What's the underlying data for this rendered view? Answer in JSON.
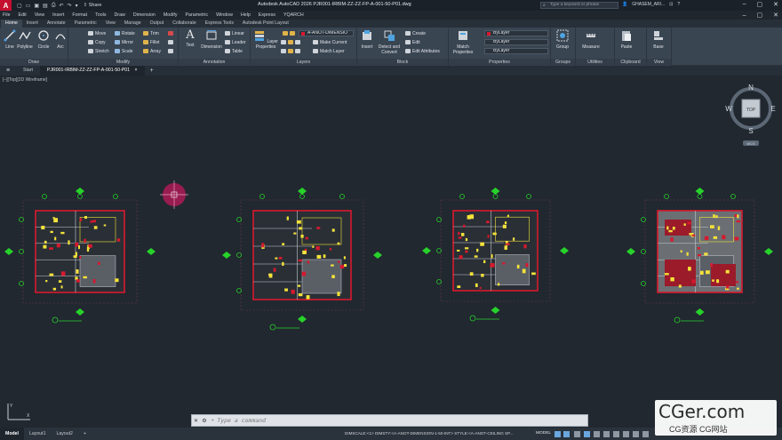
{
  "titlebar": {
    "logo": "A",
    "share_label": "Share",
    "doc_title": "Autodesk AutoCAD 2026    PJR001-IRBIM-ZZ-ZZ-FP-A-001-50-P01.dwg",
    "search_placeholder": "Type a keyword or phrase",
    "user_name": "GHASEM_ARI..."
  },
  "menubar": {
    "items": [
      "File",
      "Edit",
      "View",
      "Insert",
      "Format",
      "Tools",
      "Draw",
      "Dimension",
      "Modify",
      "Parametric",
      "Window",
      "Help",
      "Express",
      "YQARCH"
    ]
  },
  "ribbon_tabs": {
    "items": [
      "Home",
      "Insert",
      "Annotate",
      "Parametric",
      "View",
      "Manage",
      "Output",
      "Collaborate",
      "Express Tools",
      "Autodesk Point Layout"
    ]
  },
  "ribbon": {
    "draw": {
      "label": "Draw",
      "line": "Line",
      "polyline": "Polyline",
      "circle": "Circle",
      "arc": "Arc"
    },
    "modify": {
      "label": "Modify",
      "move": "Move",
      "rotate": "Rotate",
      "trim": "Trim",
      "copy": "Copy",
      "mirror": "Mirror",
      "fillet": "Fillet",
      "stretch": "Stretch",
      "scale": "Scale",
      "array": "Array"
    },
    "annotation": {
      "label": "Annotation",
      "text": "Text",
      "dimension": "Dimension",
      "linear": "Linear",
      "leader": "Leader",
      "table": "Table"
    },
    "layers": {
      "label": "Layers",
      "layer_properties": "Layer Properties",
      "current_layer": "A-ANOT-DIMENSIO",
      "make_current": "Make Current",
      "match_layer": "Match Layer"
    },
    "block": {
      "label": "Block",
      "insert": "Insert",
      "detect": "Detect and Convert",
      "create": "Create",
      "edit": "Edit",
      "edit_attributes": "Edit Attributes"
    },
    "properties": {
      "label": "Properties",
      "match": "Match Properties",
      "color": "ByLayer",
      "linetype": "ByLayer",
      "lineweight": "ByLayer"
    },
    "groups": {
      "label": "Groups",
      "group": "Group"
    },
    "utilities": {
      "label": "Utilities",
      "measure": "Measure"
    },
    "clipboard": {
      "label": "Clipboard",
      "paste": "Paste"
    },
    "view": {
      "label": "View",
      "base": "Base"
    }
  },
  "doc_tabs": {
    "start": "Start",
    "active_file": "PJR001-IRBIM-ZZ-ZZ-FP-A-001-50-P01",
    "close": "×",
    "plus": "+"
  },
  "canvas": {
    "viewport_label": "[–][Top][2D Wireframe]",
    "background": "#212830"
  },
  "viewcube": {
    "north": "N",
    "south": "S",
    "east": "E",
    "west": "W",
    "top": "TOP",
    "wcs": "WCS"
  },
  "cmdline": {
    "prompt": "▸",
    "placeholder": "Type a command"
  },
  "statusbar": {
    "tabs": [
      "Model",
      "Layout1",
      "Layout2"
    ],
    "plus": "+",
    "status_text": "DIMSCALE:<1> DIMSTY:<A-ANOT-DIMENSION-1-50-INT> STYLE:<A-ANOT-CEILING SP...",
    "model_flag": "MODEL"
  },
  "watermark": {
    "main": "CGer.com",
    "sub": "CG资源 CG网站"
  },
  "colors": {
    "wall_red": "#d8192d",
    "marker_green": "#27d22a",
    "furniture_yellow": "#f4e23a",
    "crosshair": "#c0185a",
    "accent": "#3a4552"
  }
}
